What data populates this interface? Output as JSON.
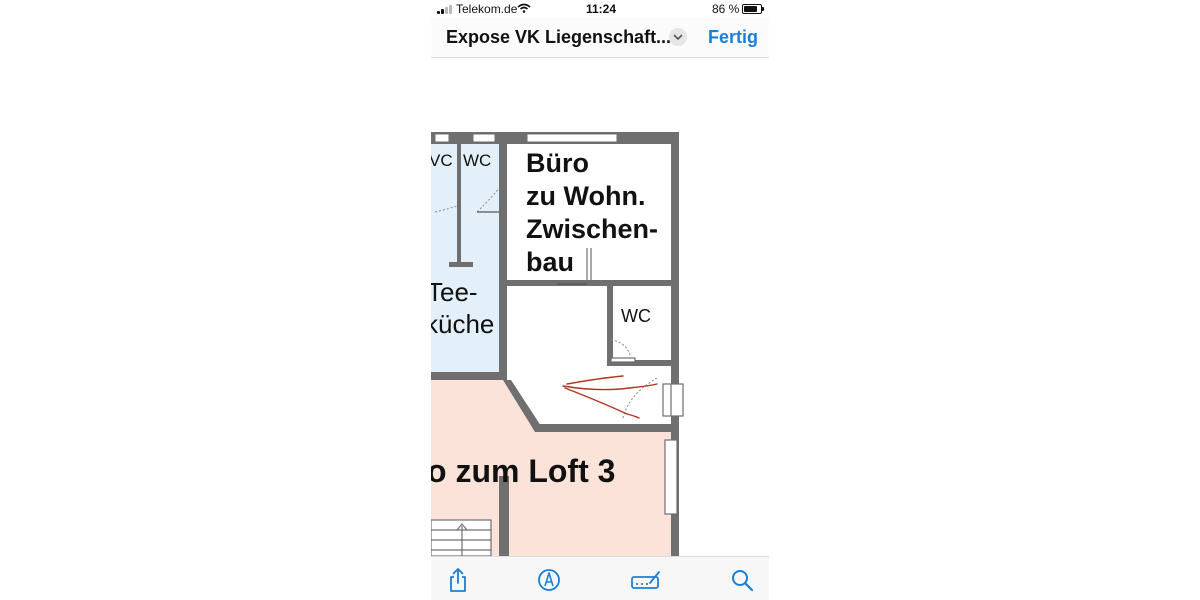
{
  "status_bar": {
    "carrier": "Telekom.de",
    "time": "11:24",
    "battery_percent": "86 %",
    "battery_level": 0.86,
    "signal_bars": 2
  },
  "nav_bar": {
    "title": "Expose VK Liegenschaft...",
    "done_label": "Fertig"
  },
  "floor_plan": {
    "rooms": {
      "wc_1": "VC",
      "wc_2": "WC",
      "buero_line1": "Büro",
      "buero_line2": "zu Wohn.",
      "buero_line3": "Zwischen-",
      "buero_line4": "bau",
      "teekueche_line1": "Tee-",
      "teekueche_line2": "küche",
      "wc_3": "WC",
      "loft": "o zum Loft 3"
    },
    "colors": {
      "wall": "#6f6f6f",
      "blue_area": "#e3f0fa",
      "pink_area": "#fbe3da",
      "annotation": "#b0361f",
      "accent": "#1a7fd6"
    }
  },
  "toolbar": {
    "icons": [
      "share-icon",
      "markup-icon",
      "signature-icon",
      "search-icon"
    ]
  }
}
